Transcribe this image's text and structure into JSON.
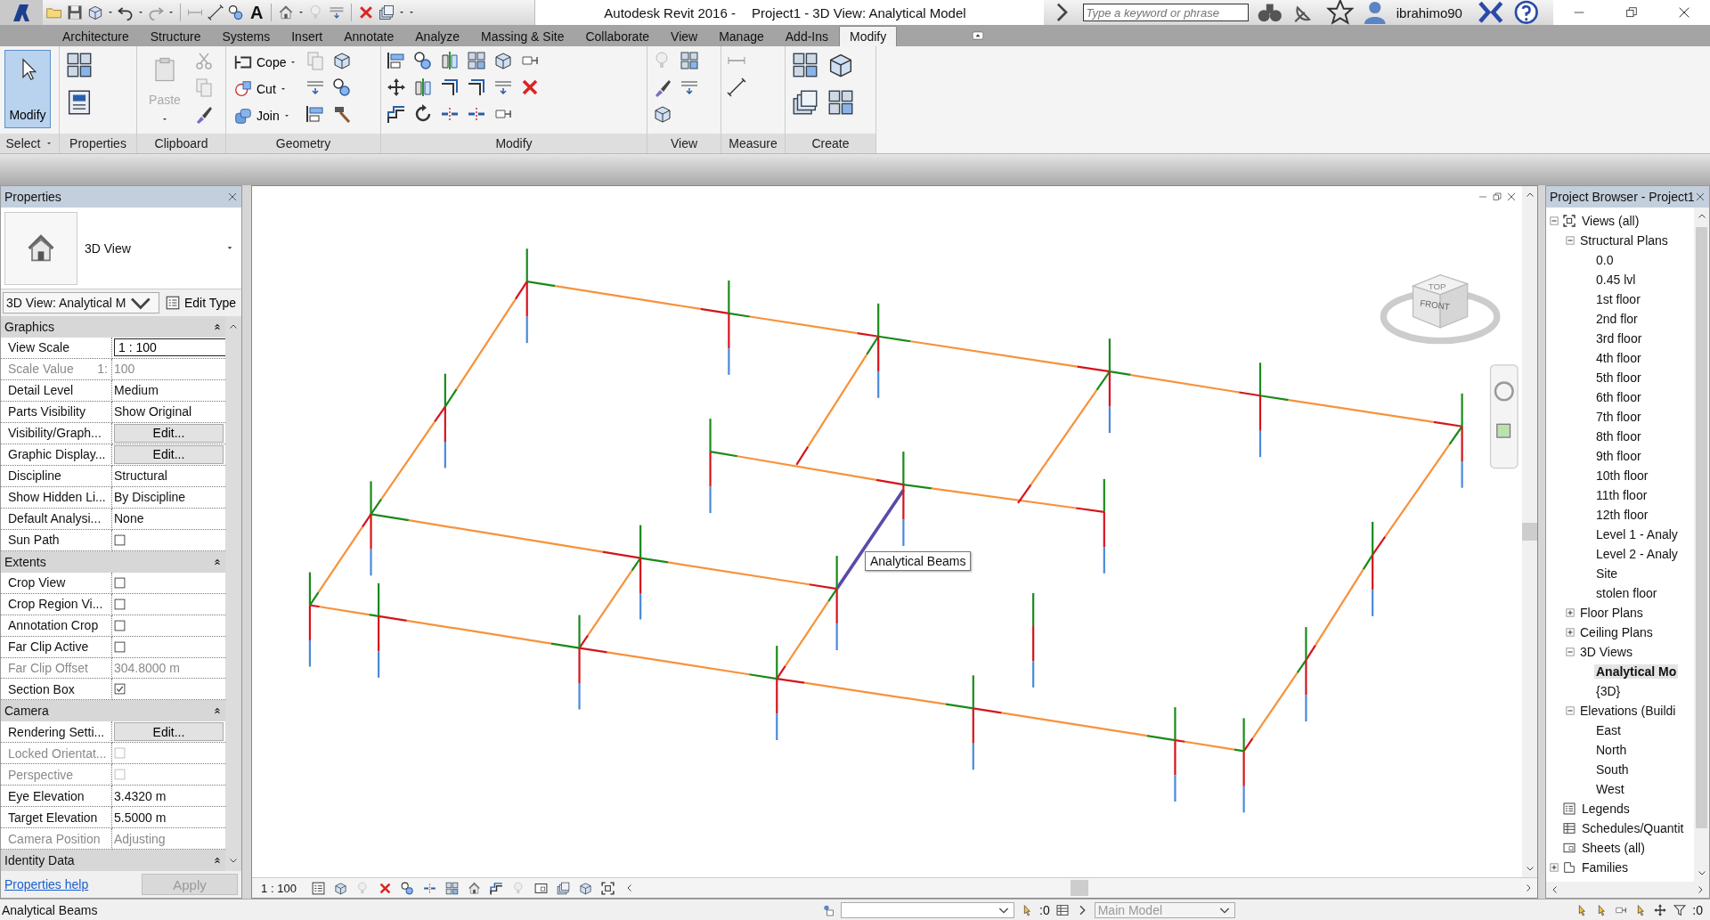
{
  "title_bar": {
    "quick_access_text": "A",
    "app_title": "Autodesk Revit 2016 -",
    "document_title": "Project1 - 3D View: Analytical Model",
    "search": {
      "placeholder": "Type a keyword or phrase"
    },
    "user": "ibrahimo90"
  },
  "ribbon": {
    "tabs": [
      {
        "label": "Architecture",
        "selected": false
      },
      {
        "label": "Structure",
        "selected": false
      },
      {
        "label": "Systems",
        "selected": false
      },
      {
        "label": "Insert",
        "selected": false
      },
      {
        "label": "Annotate",
        "selected": false
      },
      {
        "label": "Analyze",
        "selected": false
      },
      {
        "label": "Massing & Site",
        "selected": false
      },
      {
        "label": "Collaborate",
        "selected": false
      },
      {
        "label": "View",
        "selected": false
      },
      {
        "label": "Manage",
        "selected": false
      },
      {
        "label": "Add-Ins",
        "selected": false
      },
      {
        "label": "Modify",
        "selected": true
      }
    ],
    "panels": [
      {
        "label": "Select",
        "menu": true,
        "buttons": [
          {
            "label": "Modify",
            "selected": true,
            "disabled": false
          }
        ]
      },
      {
        "label": "Properties"
      },
      {
        "label": "Clipboard",
        "buttons": [
          {
            "label": "Paste",
            "selected": false,
            "disabled": true
          }
        ]
      },
      {
        "label": "Geometry",
        "buttons": [
          {
            "label": "Cope",
            "selected": false,
            "disabled": false
          },
          {
            "label": "Cut",
            "selected": false,
            "disabled": false
          },
          {
            "label": "Join",
            "selected": false,
            "disabled": false
          }
        ]
      },
      {
        "label": "Modify"
      },
      {
        "label": "View"
      },
      {
        "label": "Measure"
      },
      {
        "label": "Create"
      }
    ]
  },
  "properties": {
    "title": "Properties",
    "type_name": "3D View",
    "instance": "3D View: Analytical M",
    "edit_type": "Edit Type",
    "sections": [
      {
        "name": "Graphics",
        "expanded": true,
        "rows": [
          {
            "kind": "input",
            "label": "View Scale",
            "value": "1 : 100",
            "disabled": false
          },
          {
            "kind": "text",
            "label": "Scale Value",
            "label_suffix": "1:",
            "value": "100",
            "disabled": true
          },
          {
            "kind": "text",
            "label": "Detail Level",
            "value": "Medium",
            "disabled": false
          },
          {
            "kind": "text",
            "label": "Parts Visibility",
            "value": "Show Original",
            "disabled": false
          },
          {
            "kind": "button",
            "label": "Visibility/Graph...",
            "value": "Edit...",
            "disabled": false
          },
          {
            "kind": "button",
            "label": "Graphic Display...",
            "value": "Edit...",
            "disabled": false
          },
          {
            "kind": "text",
            "label": "Discipline",
            "value": "Structural",
            "disabled": false
          },
          {
            "kind": "text",
            "label": "Show Hidden Li...",
            "value": "By Discipline",
            "disabled": false
          },
          {
            "kind": "text",
            "label": "Default Analysi...",
            "value": "None",
            "disabled": false
          },
          {
            "kind": "checkbox",
            "label": "Sun Path",
            "checked": false,
            "disabled": false
          }
        ]
      },
      {
        "name": "Extents",
        "expanded": true,
        "rows": [
          {
            "kind": "checkbox",
            "label": "Crop View",
            "checked": false,
            "disabled": false
          },
          {
            "kind": "checkbox",
            "label": "Crop Region Vi...",
            "checked": false,
            "disabled": false
          },
          {
            "kind": "checkbox",
            "label": "Annotation Crop",
            "checked": false,
            "disabled": false
          },
          {
            "kind": "checkbox",
            "label": "Far Clip Active",
            "checked": false,
            "disabled": false
          },
          {
            "kind": "text",
            "label": "Far Clip Offset",
            "value": "304.8000 m",
            "disabled": true
          },
          {
            "kind": "checkbox",
            "label": "Section Box",
            "checked": true,
            "disabled": false
          }
        ]
      },
      {
        "name": "Camera",
        "expanded": true,
        "rows": [
          {
            "kind": "button",
            "label": "Rendering Setti...",
            "value": "Edit...",
            "disabled": false
          },
          {
            "kind": "checkbox",
            "label": "Locked Orientat...",
            "checked": false,
            "disabled": true
          },
          {
            "kind": "checkbox",
            "label": "Perspective",
            "checked": false,
            "disabled": true
          },
          {
            "kind": "text",
            "label": "Eye Elevation",
            "value": "3.4320 m",
            "disabled": false
          },
          {
            "kind": "text",
            "label": "Target Elevation",
            "value": "5.5000 m",
            "disabled": false
          },
          {
            "kind": "text",
            "label": "Camera Position",
            "value": "Adjusting",
            "disabled": true
          }
        ]
      },
      {
        "name": "Identity Data",
        "expanded": true
      }
    ],
    "help_link": "Properties help",
    "apply": {
      "label": "Apply",
      "disabled": true
    }
  },
  "view": {
    "tooltip": "Analytical Beams",
    "view_cube": {
      "front": "FRONT",
      "top": "TOP"
    },
    "scale": "1 : 100"
  },
  "project_browser": {
    "title": "Project Browser - Project1",
    "tree": [
      {
        "label": "Views (all)",
        "expanded": true,
        "selected": false,
        "children": [
          {
            "label": "Structural Plans",
            "expanded": true,
            "selected": false,
            "children": [
              {
                "label": "0.0",
                "selected": false
              },
              {
                "label": "0.45 lvl",
                "selected": false
              },
              {
                "label": "1st floor",
                "selected": false
              },
              {
                "label": "2nd flor",
                "selected": false
              },
              {
                "label": "3rd floor",
                "selected": false
              },
              {
                "label": "4th floor",
                "selected": false
              },
              {
                "label": "5th floor",
                "selected": false
              },
              {
                "label": "6th floor",
                "selected": false
              },
              {
                "label": "7th floor",
                "selected": false
              },
              {
                "label": "8th floor",
                "selected": false
              },
              {
                "label": "9th floor",
                "selected": false
              },
              {
                "label": "10th floor",
                "selected": false
              },
              {
                "label": "11th floor",
                "selected": false
              },
              {
                "label": "12th floor",
                "selected": false
              },
              {
                "label": "Level 1 - Analy",
                "selected": false
              },
              {
                "label": "Level 2 - Analy",
                "selected": false
              },
              {
                "label": "Site",
                "selected": false
              },
              {
                "label": "stolen floor",
                "selected": false
              }
            ]
          },
          {
            "label": "Floor Plans",
            "expanded": false,
            "selected": false
          },
          {
            "label": "Ceiling Plans",
            "expanded": false,
            "selected": false
          },
          {
            "label": "3D Views",
            "expanded": true,
            "selected": false,
            "children": [
              {
                "label": "Analytical Mo",
                "selected": true
              },
              {
                "label": "{3D}",
                "selected": false
              }
            ]
          },
          {
            "label": "Elevations (Buildi",
            "expanded": true,
            "selected": false,
            "children": [
              {
                "label": "East",
                "selected": false
              },
              {
                "label": "North",
                "selected": false
              },
              {
                "label": "South",
                "selected": false
              },
              {
                "label": "West",
                "selected": false
              }
            ]
          }
        ]
      },
      {
        "label": "Legends",
        "selected": false
      },
      {
        "label": "Schedules/Quantit",
        "selected": false
      },
      {
        "label": "Sheets (all)",
        "selected": false
      },
      {
        "label": "Families",
        "expanded": false,
        "selected": false
      }
    ]
  },
  "status_bar": {
    "prompt": "Analytical Beams",
    "editable_count": ":0",
    "design_option": {
      "value": "Main Model",
      "disabled": true
    },
    "filter_count": ":0"
  }
}
